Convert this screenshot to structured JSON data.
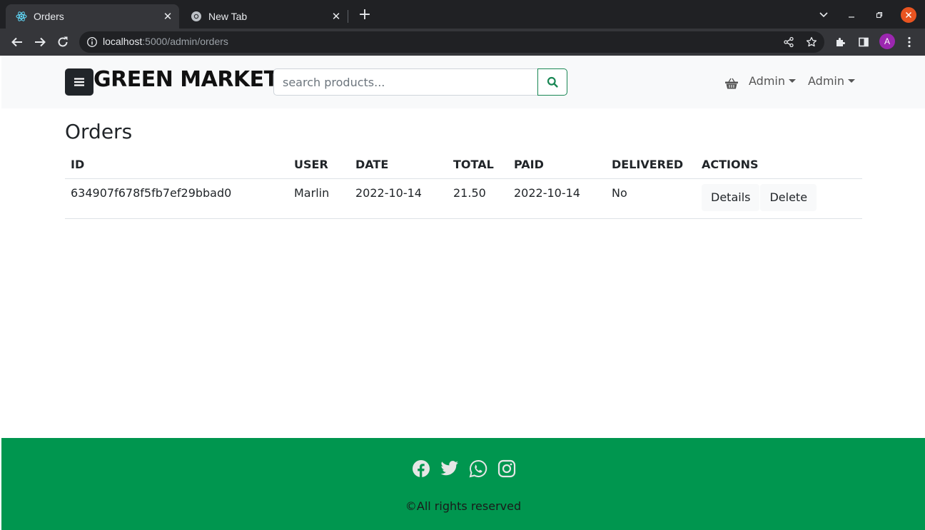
{
  "browser": {
    "tabs": [
      {
        "title": "Orders",
        "icon": "react-icon",
        "active": true
      },
      {
        "title": "New Tab",
        "icon": "chrome-icon",
        "active": false
      }
    ],
    "url_host": "localhost",
    "url_path": ":5000/admin/orders",
    "profile_initial": "A"
  },
  "navbar": {
    "brand": "GREEN MARKET",
    "search_placeholder": "search products...",
    "user_menu_label": "Admin",
    "admin_menu_label": "Admin"
  },
  "main": {
    "heading": "Orders",
    "table": {
      "headers": [
        "ID",
        "USER",
        "DATE",
        "TOTAL",
        "PAID",
        "DELIVERED",
        "ACTIONS"
      ],
      "rows": [
        {
          "id": "634907f678f5fb7ef29bbad0",
          "user": "Marlin",
          "date": "2022-10-14",
          "total": "21.50",
          "paid": "2022-10-14",
          "delivered": "No",
          "details_label": "Details",
          "delete_label": "Delete"
        }
      ]
    }
  },
  "footer": {
    "social_icons": [
      "facebook-icon",
      "twitter-icon",
      "whatsapp-icon",
      "instagram-icon"
    ],
    "copyright": "©All rights reserved"
  },
  "colors": {
    "footer_bg": "#00964f",
    "search_button_border": "#198754",
    "navbar_bg": "#f8f9fa",
    "brand_button_bg": "#212529"
  }
}
